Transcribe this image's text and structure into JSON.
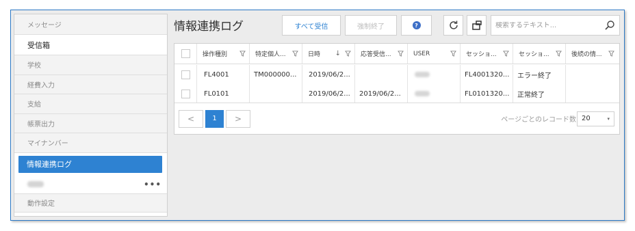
{
  "sidebar": {
    "items": [
      {
        "label": "メッセージ"
      },
      {
        "label": "受信箱"
      },
      {
        "label": "学校"
      },
      {
        "label": "経費入力"
      },
      {
        "label": "支給"
      },
      {
        "label": "帳票出力"
      },
      {
        "label": "マイナンバー"
      },
      {
        "label": "情報連携ログ"
      },
      {
        "label": "動作設定"
      }
    ],
    "sub_more": "•••"
  },
  "header": {
    "title": "情報連携ログ",
    "receive_all_label": "すべて受信",
    "force_end_label": "強制終了",
    "help_glyph": "?"
  },
  "search": {
    "placeholder": "検索するテキスト..."
  },
  "table": {
    "columns": [
      "操作種別",
      "特定個人...",
      "日時",
      "応答受信...",
      "USER",
      "セッショ...",
      "セッショ...",
      "後続の情..."
    ],
    "sort_glyph": "↓",
    "rows": [
      [
        "FL4001",
        "TM000000...",
        "2019/06/2...",
        "",
        "",
        "FL4001320...",
        "エラー終了",
        ""
      ],
      [
        "FL0101",
        "",
        "2019/06/2...",
        "2019/06/2...",
        "",
        "FL0101320...",
        "正常終了",
        ""
      ]
    ]
  },
  "pager": {
    "prev": "<",
    "current": "1",
    "next": ">",
    "page_size_label": "ページごとのレコード数",
    "page_size": "20",
    "caret": "▾"
  }
}
